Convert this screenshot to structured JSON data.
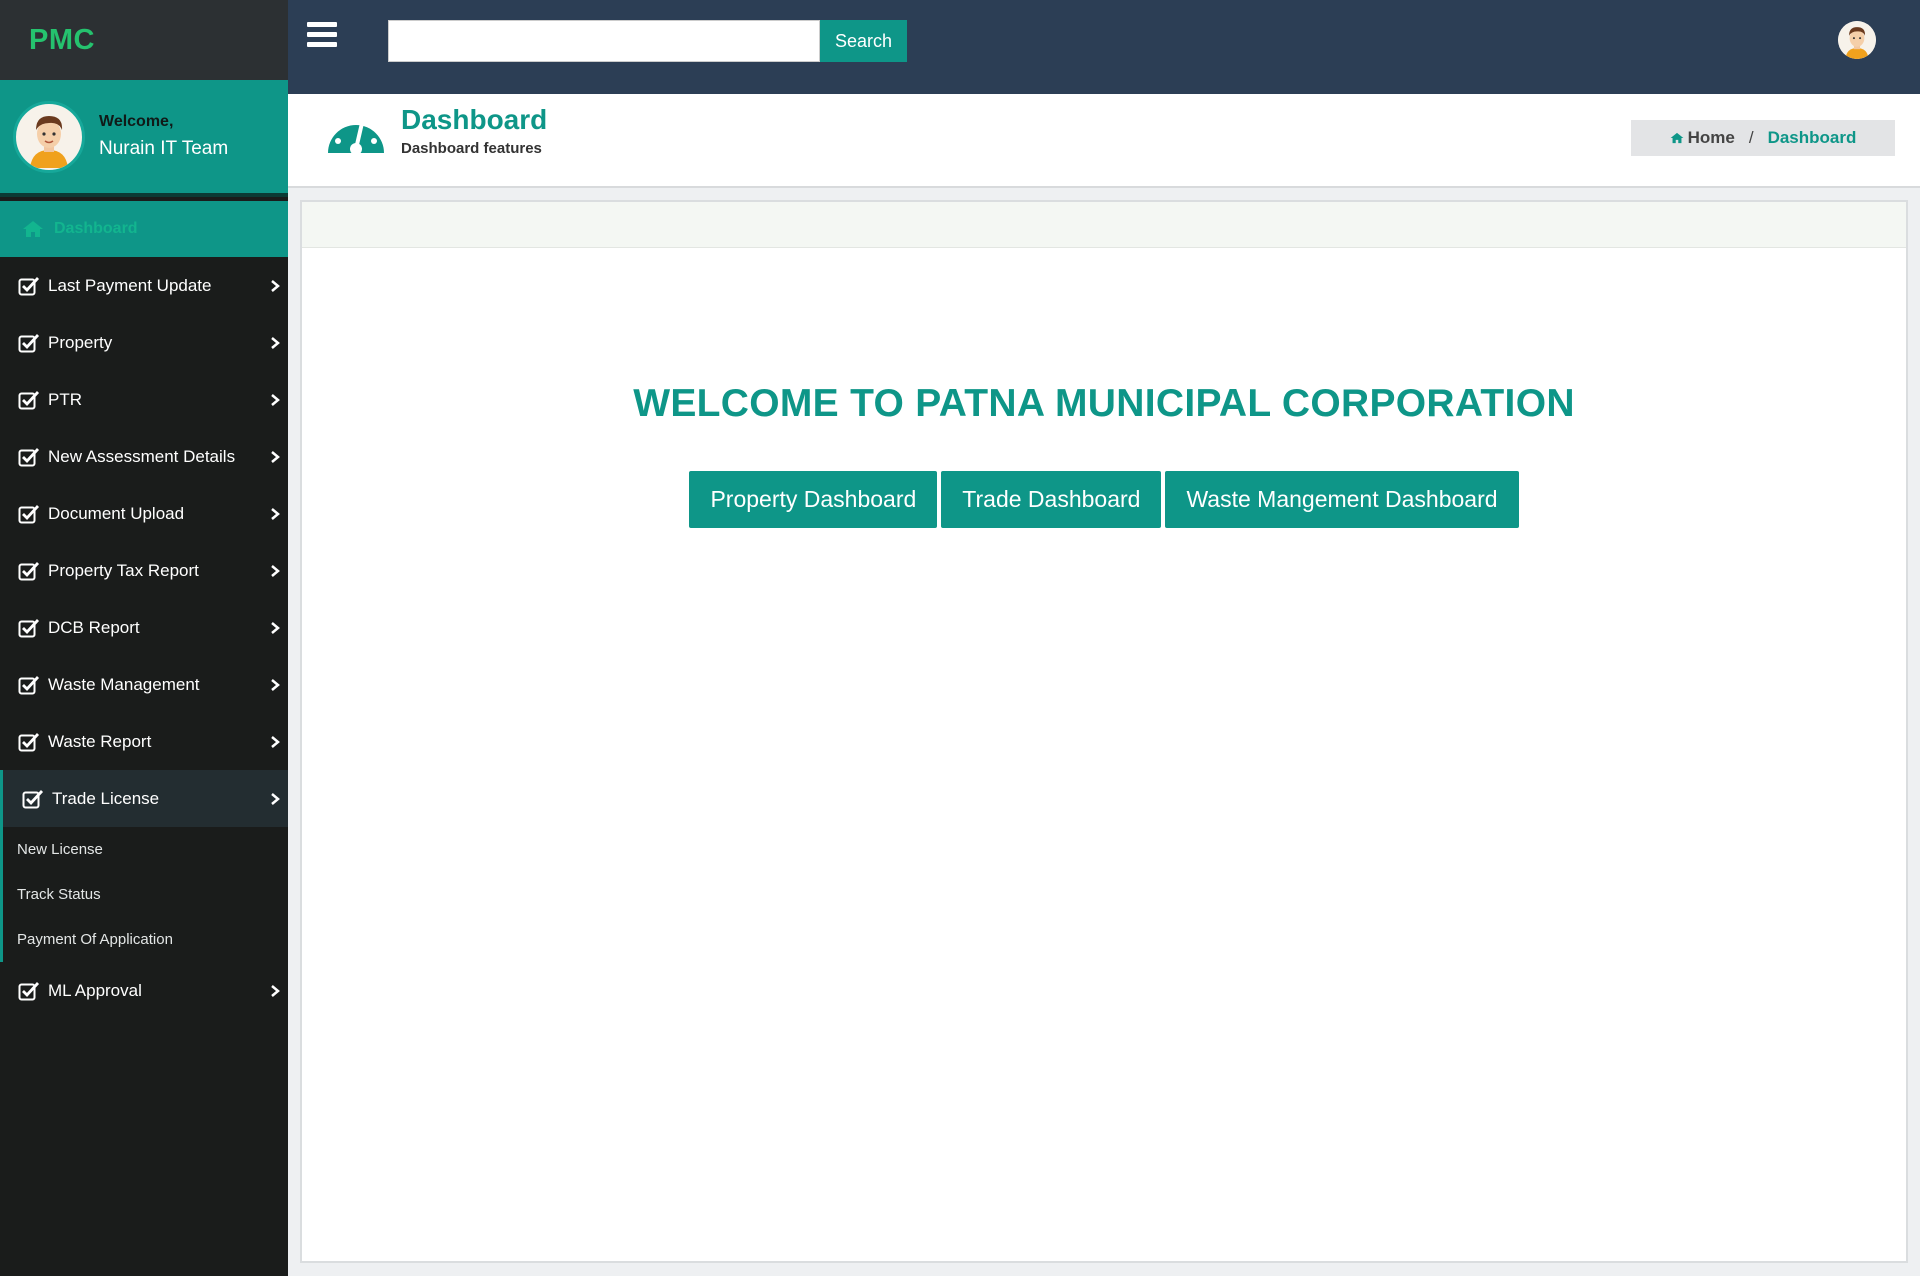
{
  "brand": "PMC",
  "user": {
    "greeting": "Welcome,",
    "name": "Nurain IT Team"
  },
  "search": {
    "placeholder": "",
    "button_label": "Search"
  },
  "sidebar": {
    "active_item": "Dashboard",
    "items": [
      {
        "label": "Last Payment Update"
      },
      {
        "label": "Property"
      },
      {
        "label": "PTR"
      },
      {
        "label": "New Assessment Details"
      },
      {
        "label": "Document Upload"
      },
      {
        "label": "Property Tax Report"
      },
      {
        "label": "DCB Report"
      },
      {
        "label": "Waste Management"
      },
      {
        "label": "Waste Report"
      },
      {
        "label": "Trade License"
      },
      {
        "label": "ML Approval"
      }
    ],
    "trade_license_sub": [
      {
        "label": "New License"
      },
      {
        "label": "Track Status"
      },
      {
        "label": "Payment Of Application"
      }
    ]
  },
  "page_header": {
    "title": "Dashboard",
    "subtitle": "Dashboard features"
  },
  "breadcrumb": {
    "home": "Home",
    "separator": "/",
    "current": "Dashboard"
  },
  "main": {
    "welcome_title": "WELCOME TO PATNA MUNICIPAL CORPORATION",
    "buttons": [
      {
        "label": "Property Dashboard"
      },
      {
        "label": "Trade Dashboard"
      },
      {
        "label": "Waste Mangement Dashboard"
      }
    ]
  },
  "colors": {
    "accent": "#0e9688",
    "topbar": "#2c3e55",
    "sidebar": "#1a1c1b",
    "brand": "#25c26e"
  },
  "icons": {
    "menu": "hamburger-icon",
    "nav": "check-square-icon",
    "dashboard": "gauge-icon",
    "home": "home-icon",
    "expand": "chevron-right-icon"
  }
}
